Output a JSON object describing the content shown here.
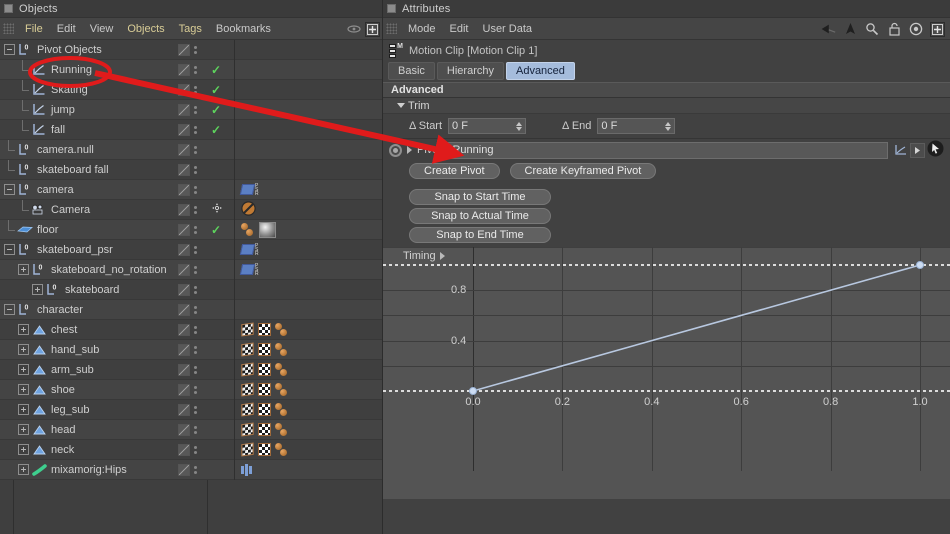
{
  "objects_panel": {
    "title": "Objects",
    "menu": [
      "File",
      "Edit",
      "View",
      "Objects",
      "Tags",
      "Bookmarks"
    ],
    "tree": [
      {
        "label": "Pivot Objects",
        "depth": 0,
        "icon": "null-object-icon",
        "expander": "minus",
        "check": false,
        "alt": false,
        "tags": []
      },
      {
        "label": "Running",
        "depth": 1,
        "icon": "motion-clip-icon",
        "expander": "none",
        "check": true,
        "alt": true,
        "tags": []
      },
      {
        "label": "Skating",
        "depth": 1,
        "icon": "motion-clip-icon",
        "expander": "none",
        "check": true,
        "alt": false,
        "tags": []
      },
      {
        "label": "jump",
        "depth": 1,
        "icon": "motion-clip-icon",
        "expander": "none",
        "check": true,
        "alt": true,
        "tags": []
      },
      {
        "label": "fall",
        "depth": 1,
        "icon": "motion-clip-icon",
        "expander": "none",
        "check": true,
        "alt": false,
        "tags": []
      },
      {
        "label": "camera.null",
        "depth": 0,
        "icon": "null-object-icon",
        "expander": "none",
        "check": false,
        "alt": true,
        "tags": []
      },
      {
        "label": "skateboard fall",
        "depth": 0,
        "icon": "null-object-icon",
        "expander": "none",
        "check": false,
        "alt": false,
        "tags": []
      },
      {
        "label": "camera",
        "depth": 0,
        "icon": "null-object-icon",
        "expander": "minus",
        "check": false,
        "alt": true,
        "tags": [
          "psr-tag"
        ]
      },
      {
        "label": "Camera",
        "depth": 1,
        "icon": "camera-icon",
        "expander": "none",
        "check": false,
        "alt": false,
        "tags": [
          "protection-tag"
        ],
        "mid_icon": "move-gizmo-icon"
      },
      {
        "label": "floor",
        "depth": 0,
        "icon": "floor-plane-icon",
        "expander": "none",
        "check": true,
        "alt": true,
        "tags": [
          "ball-pair-tag",
          "material-sphere-tag"
        ]
      },
      {
        "label": "skateboard_psr",
        "depth": 0,
        "icon": "null-object-icon",
        "expander": "minus",
        "check": false,
        "alt": false,
        "tags": [
          "psr-tag"
        ]
      },
      {
        "label": "skateboard_no_rotation",
        "depth": 1,
        "icon": "null-object-icon",
        "expander": "plus",
        "check": false,
        "alt": true,
        "tags": [
          "psr-tag"
        ]
      },
      {
        "label": "skateboard",
        "depth": 2,
        "icon": "null-object-icon",
        "expander": "plus",
        "check": false,
        "alt": false,
        "tags": []
      },
      {
        "label": "character",
        "depth": 0,
        "icon": "null-object-icon",
        "expander": "minus",
        "check": false,
        "alt": true,
        "tags": []
      },
      {
        "label": "chest",
        "depth": 1,
        "icon": "polygon-object-icon",
        "expander": "plus",
        "check": false,
        "alt": false,
        "tags": [
          "tex-skew-tag",
          "tex-tag",
          "ball-pair-tag"
        ]
      },
      {
        "label": "hand_sub",
        "depth": 1,
        "icon": "polygon-object-icon",
        "expander": "plus",
        "check": false,
        "alt": true,
        "tags": [
          "tex-skew-tag",
          "tex-tag",
          "ball-pair-tag"
        ]
      },
      {
        "label": "arm_sub",
        "depth": 1,
        "icon": "polygon-object-icon",
        "expander": "plus",
        "check": false,
        "alt": false,
        "tags": [
          "tex-skew-tag",
          "tex-tag",
          "ball-pair-tag"
        ]
      },
      {
        "label": "shoe",
        "depth": 1,
        "icon": "polygon-object-icon",
        "expander": "plus",
        "check": false,
        "alt": true,
        "tags": [
          "tex-skew-tag",
          "tex-tag",
          "ball-pair-tag"
        ]
      },
      {
        "label": "leg_sub",
        "depth": 1,
        "icon": "polygon-object-icon",
        "expander": "plus",
        "check": false,
        "alt": false,
        "tags": [
          "tex-skew-tag",
          "tex-tag",
          "ball-pair-tag"
        ]
      },
      {
        "label": "head",
        "depth": 1,
        "icon": "polygon-object-icon",
        "expander": "plus",
        "check": false,
        "alt": true,
        "tags": [
          "tex-skew-tag",
          "tex-tag",
          "ball-pair-tag"
        ]
      },
      {
        "label": "neck",
        "depth": 1,
        "icon": "polygon-object-icon",
        "expander": "plus",
        "check": false,
        "alt": false,
        "tags": [
          "tex-skew-tag",
          "tex-tag",
          "ball-pair-tag"
        ]
      },
      {
        "label": "mixamorig:Hips",
        "depth": 1,
        "icon": "joint-icon",
        "expander": "plus",
        "check": false,
        "alt": true,
        "tags": [
          "joint-tag"
        ]
      }
    ]
  },
  "attributes_panel": {
    "title": "Attributes",
    "menu": [
      "Mode",
      "Edit",
      "User Data"
    ],
    "toolbar_icons": [
      "back-arrow-icon",
      "up-arrow-icon",
      "search-icon",
      "lock-icon",
      "target-icon",
      "new-window-icon"
    ],
    "object_name": "Motion Clip [Motion Clip 1]",
    "tabs": [
      {
        "label": "Basic",
        "active": false
      },
      {
        "label": "Hierarchy",
        "active": false
      },
      {
        "label": "Advanced",
        "active": true
      }
    ],
    "section_title": "Advanced",
    "trim": {
      "group_label": "Trim",
      "start_label": "Δ Start",
      "start_value": "0 F",
      "end_label": "Δ End",
      "end_value": "0 F"
    },
    "pivot": {
      "label": "Pivot",
      "value": "Running"
    },
    "buttons": {
      "create_pivot": "Create Pivot",
      "create_keyframed_pivot": "Create Keyframed Pivot",
      "snap_start": "Snap to Start Time",
      "snap_actual": "Snap to Actual Time",
      "snap_end": "Snap to End Time"
    },
    "timing": {
      "label": "Timing"
    }
  },
  "chart_data": {
    "type": "line",
    "title": "Timing",
    "xlabel": "",
    "ylabel": "",
    "x_ticks": [
      "0.0",
      "0.2",
      "0.4",
      "0.6",
      "0.8",
      "1.0"
    ],
    "x_tick_values": [
      0.0,
      0.2,
      0.4,
      0.6,
      0.8,
      1.0
    ],
    "y_ticks": [
      "0.4",
      "0.8"
    ],
    "y_tick_values": [
      0.4,
      0.8
    ],
    "xlim": [
      0.0,
      1.0
    ],
    "ylim": [
      0.0,
      1.0
    ],
    "grid": true,
    "legend": "none",
    "series": [
      {
        "name": "timing-curve",
        "color": "#b8c8e0",
        "x": [
          0.0,
          1.0
        ],
        "y": [
          0.0,
          1.0
        ],
        "points": [
          {
            "x": 0.0,
            "y": 0.0
          },
          {
            "x": 1.0,
            "y": 1.0
          }
        ]
      }
    ],
    "guides": [
      {
        "type": "hline",
        "y": 0.0,
        "style": "dotted",
        "color": "#dcdcdc"
      },
      {
        "type": "hline",
        "y": 1.0,
        "style": "dotted",
        "color": "#dcdcdc"
      }
    ]
  },
  "annotation": {
    "ellipse_target": "Running",
    "arrow_color": "#e01b1b",
    "arrow_from": "Running",
    "arrow_to": "Pivot"
  },
  "colors": {
    "panel_bg": "#414141",
    "tree_bg": "#3f3f3f",
    "row_alt": "#444444",
    "accent_tab": "#a5bcdc",
    "check_green": "#5dd35d",
    "annotation_red": "#e01b1b",
    "graph_bg": "#545454",
    "curve": "#b8c8e0"
  }
}
